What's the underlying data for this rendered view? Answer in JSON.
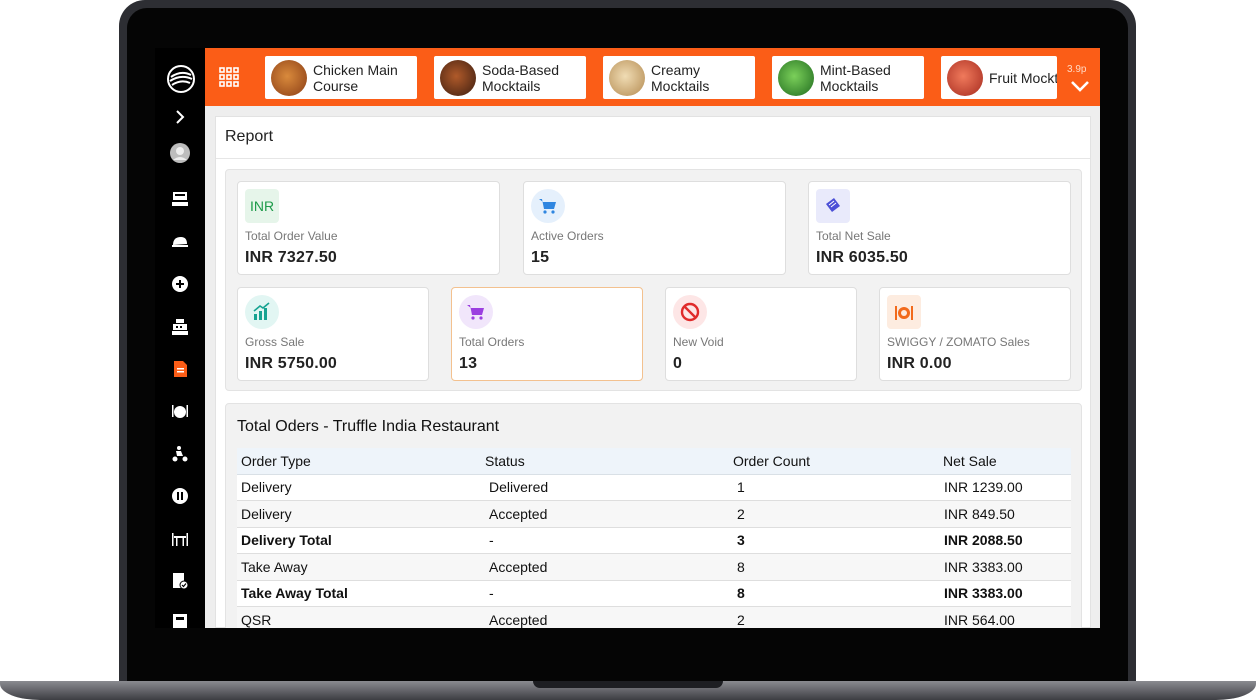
{
  "categories": [
    {
      "label": "Chicken Main Course",
      "color": "#b0612e"
    },
    {
      "label": "Soda-Based Mocktails",
      "color": "#6b3b22"
    },
    {
      "label": "Creamy Mocktails",
      "color": "#d8b98a"
    },
    {
      "label": "Mint-Based Mocktails",
      "color": "#3f8f2e"
    },
    {
      "label": "Fruit Mocktails",
      "color": "#d94a3a"
    }
  ],
  "topbar": {
    "time": "3.9p"
  },
  "report": {
    "title": "Report"
  },
  "cards": [
    {
      "label": "Total Order Value",
      "value": "INR  7327.50",
      "icon": "INR",
      "icon_bg": "#e6f5ea",
      "icon_color": "#1e9b4a"
    },
    {
      "label": "Active Orders",
      "value": "15",
      "icon": "cart-icon",
      "icon_bg": "#e5f0fc",
      "icon_color": "#2f86e0"
    },
    {
      "label": "Total Net Sale",
      "value": "INR  6035.50",
      "icon": "ticket-icon",
      "icon_bg": "#e9eafb",
      "icon_color": "#4b4fd6"
    },
    {
      "label": "Gross Sale",
      "value": "INR  5750.00",
      "icon": "chart-up-icon",
      "icon_bg": "#e2f6f3",
      "icon_color": "#16a391"
    },
    {
      "label": "Total Orders",
      "value": "13",
      "icon": "cart-icon",
      "icon_bg": "#f1e6fb",
      "icon_color": "#9b3fe0"
    },
    {
      "label": "New Void",
      "value": "0",
      "icon": "void-icon",
      "icon_bg": "#fde6e6",
      "icon_color": "#e02b2b"
    },
    {
      "label": "SWIGGY / ZOMATO Sales",
      "value": "INR  0.00",
      "icon": "delivery-dish-icon",
      "icon_bg": "#fdece0",
      "icon_color": "#f26a1b"
    }
  ],
  "orders": {
    "title": "Total Oders - Truffle India Restaurant",
    "headers": [
      "Order Type",
      "Status",
      "Order Count",
      "Net Sale"
    ],
    "rows": [
      [
        "Delivery",
        "Delivered",
        "1",
        "INR  1239.00"
      ],
      [
        "Delivery",
        "Accepted",
        "2",
        "INR  849.50"
      ],
      [
        "Delivery Total",
        "-",
        "3",
        "INR  2088.50"
      ],
      [
        "Take Away",
        "Accepted",
        "8",
        "INR  3383.00"
      ],
      [
        "Take Away Total",
        "-",
        "8",
        "INR  3383.00"
      ],
      [
        "QSR",
        "Accepted",
        "2",
        "INR  564.00"
      ]
    ]
  },
  "colors": {
    "accent": "#fb5d17",
    "sidebar": "#000000",
    "active_sidebar": "#fb5d17"
  }
}
